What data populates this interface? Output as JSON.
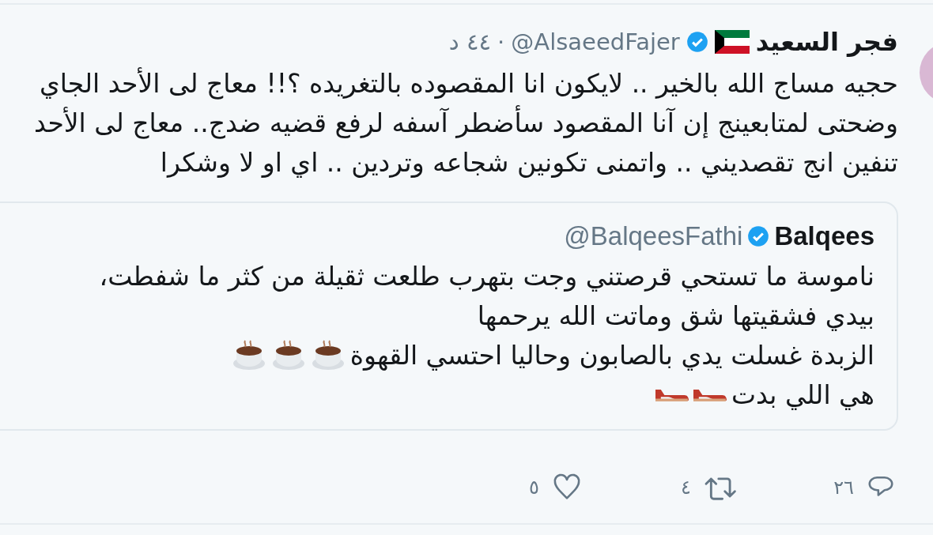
{
  "tweet": {
    "author": {
      "name": "فجر السعيد",
      "handle": "@AlsaeedFajer",
      "verified": true
    },
    "separator": "·",
    "time": "٤٤ د",
    "text_lines": [
      "حجيه مساج الله بالخير .. لايكون انا المقصوده بالتغريده ؟!! معاج لى الأحد الجاي",
      "وضحتى لمتابعينج إن آنا المقصود سأضطر آسفه لرفع قضيه ضدج.. معاج لى الأحد",
      "تنفين انج تقصديني .. واتمنى تكونين شجاعه وتردين .. اي او لا وشكرا"
    ],
    "quote": {
      "author": {
        "name": "Balqees",
        "handle": "@BalqeesFathi",
        "verified": true
      },
      "lines": [
        {
          "text": "ناموسة ما تستحي قرصتني وجت بتهرب طلعت ثقيلة من كثر ما شفطت،",
          "kind": "plain"
        },
        {
          "text": "بيدي فشقيتها شق وماتت الله يرحمها",
          "kind": "plain"
        },
        {
          "text": "الزبدة غسلت يدي بالصابون وحاليا احتسي القهوة",
          "kind": "coffees"
        },
        {
          "text": "هي اللي بدت",
          "kind": "heels"
        }
      ]
    },
    "actions": [
      {
        "kind": "reply",
        "count": "٢٦"
      },
      {
        "kind": "retweet",
        "count": "٤"
      },
      {
        "kind": "like",
        "count": "٥"
      }
    ]
  }
}
